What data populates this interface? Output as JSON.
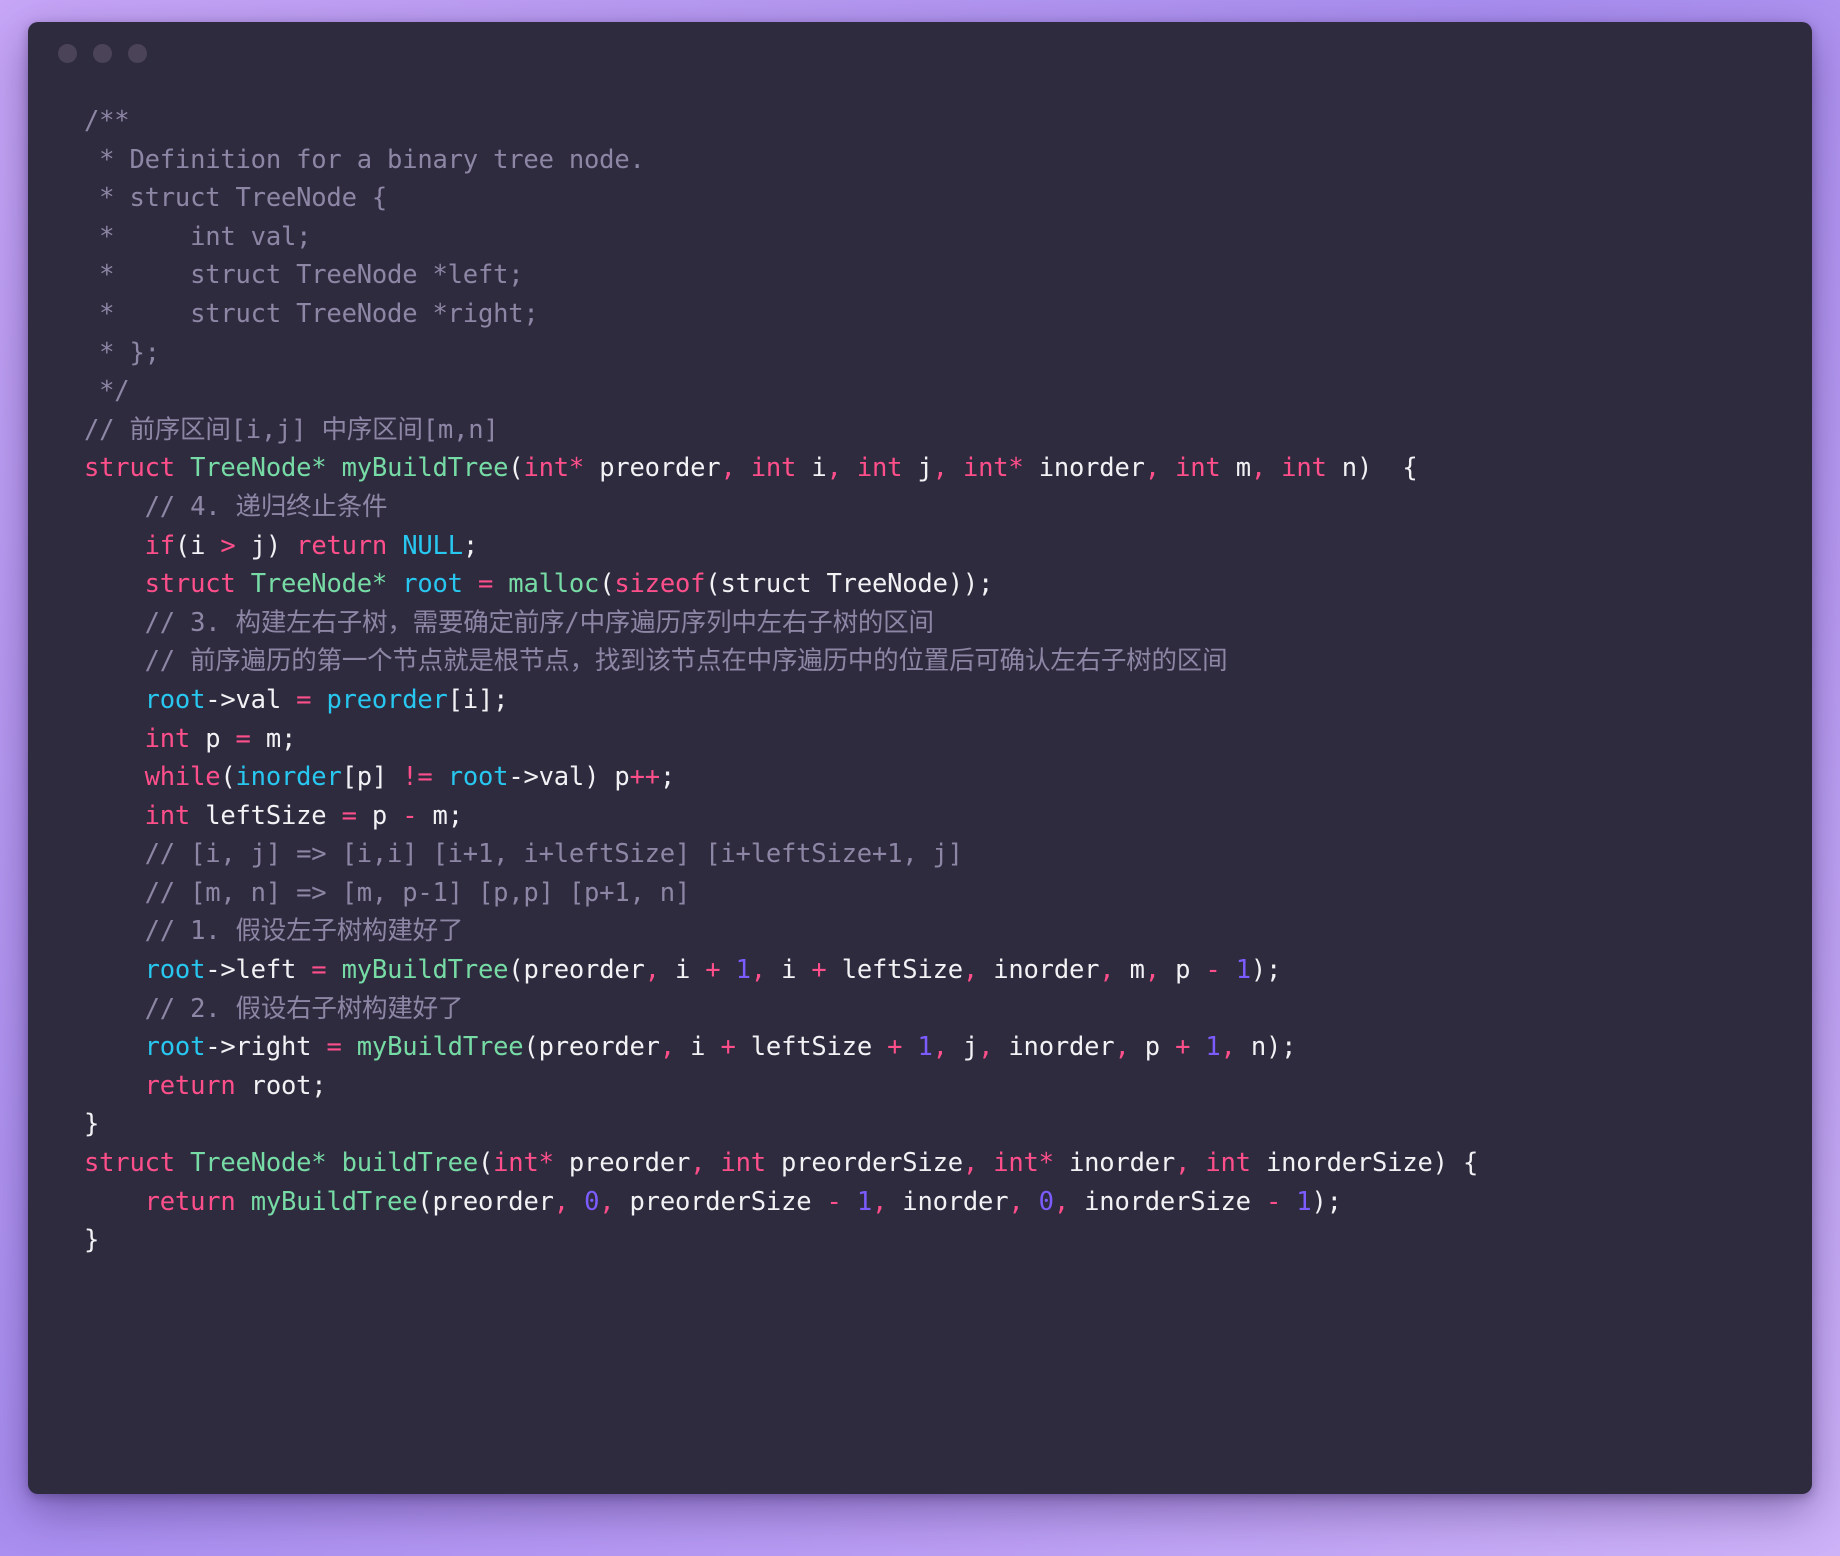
{
  "window": {
    "title": "",
    "traffic_lights": [
      {
        "name": "close",
        "color": "#4b4459"
      },
      {
        "name": "minimize",
        "color": "#4b4459"
      },
      {
        "name": "maximize",
        "color": "#4b4459"
      }
    ],
    "background_gradient": [
      "#c7a6f7",
      "#a98ef0",
      "#cdb2f8"
    ],
    "editor_background": "#2f2b3f"
  },
  "theme": {
    "comment": "#8d86a5",
    "keyword": "#ff4f8b",
    "function": "#76dba5",
    "type": "#76dba5",
    "variable": "#28c7f0",
    "number": "#7c5cff",
    "plain": "#f2f2f5"
  },
  "code": {
    "language": "c",
    "lines": [
      "/**",
      " * Definition for a binary tree node.",
      " * struct TreeNode {",
      " *     int val;",
      " *     struct TreeNode *left;",
      " *     struct TreeNode *right;",
      " * };",
      " */",
      "// 前序区间[i,j] 中序区间[m,n]",
      "struct TreeNode* myBuildTree(int* preorder, int i, int j, int* inorder, int m, int n)  {",
      "    // 4. 递归终止条件",
      "    if(i > j) return NULL;",
      "    struct TreeNode* root = malloc(sizeof(struct TreeNode));",
      "    // 3. 构建左右子树，需要确定前序/中序遍历序列中左右子树的区间",
      "    // 前序遍历的第一个节点就是根节点，找到该节点在中序遍历中的位置后可确认左右子树的区间",
      "    root->val = preorder[i];",
      "    int p = m;",
      "    while(inorder[p] != root->val) p++;",
      "    int leftSize = p - m;",
      "    // [i, j] => [i,i] [i+1, i+leftSize] [i+leftSize+1, j]",
      "    // [m, n] => [m, p-1] [p,p] [p+1, n]",
      "    // 1. 假设左子树构建好了",
      "    root->left = myBuildTree(preorder, i + 1, i + leftSize, inorder, m, p - 1);",
      "    // 2. 假设右子树构建好了",
      "    root->right = myBuildTree(preorder, i + leftSize + 1, j, inorder, p + 1, n);",
      "    return root;",
      "}",
      "struct TreeNode* buildTree(int* preorder, int preorderSize, int* inorder, int inorderSize) {",
      "    return myBuildTree(preorder, 0, preorderSize - 1, inorder, 0, inorderSize - 1);",
      "}"
    ],
    "tokens": [
      [
        [
          "cmt",
          "/**"
        ]
      ],
      [
        [
          "cmt",
          " * Definition for a binary tree node."
        ]
      ],
      [
        [
          "cmt",
          " * struct TreeNode {"
        ]
      ],
      [
        [
          "cmt",
          " *     int val;"
        ]
      ],
      [
        [
          "cmt",
          " *     struct TreeNode *left;"
        ]
      ],
      [
        [
          "cmt",
          " *     struct TreeNode *right;"
        ]
      ],
      [
        [
          "cmt",
          " * };"
        ]
      ],
      [
        [
          "cmt",
          " */"
        ]
      ],
      [
        [
          "cmt",
          "// 前序区间[i,j] 中序区间[m,n]"
        ]
      ],
      [
        [
          "kw",
          "struct"
        ],
        [
          "txt",
          " "
        ],
        [
          "typ",
          "TreeNode*"
        ],
        [
          "txt",
          " "
        ],
        [
          "fn",
          "myBuildTree"
        ],
        [
          "pun",
          "("
        ],
        [
          "kw",
          "int*"
        ],
        [
          "txt",
          " preorder"
        ],
        [
          "op",
          ","
        ],
        [
          "txt",
          " "
        ],
        [
          "kw",
          "int"
        ],
        [
          "txt",
          " i"
        ],
        [
          "op",
          ","
        ],
        [
          "txt",
          " "
        ],
        [
          "kw",
          "int"
        ],
        [
          "txt",
          " j"
        ],
        [
          "op",
          ","
        ],
        [
          "txt",
          " "
        ],
        [
          "kw",
          "int*"
        ],
        [
          "txt",
          " inorder"
        ],
        [
          "op",
          ","
        ],
        [
          "txt",
          " "
        ],
        [
          "kw",
          "int"
        ],
        [
          "txt",
          " m"
        ],
        [
          "op",
          ","
        ],
        [
          "txt",
          " "
        ],
        [
          "kw",
          "int"
        ],
        [
          "txt",
          " n"
        ],
        [
          "pun",
          ")  {"
        ]
      ],
      [
        [
          "txt",
          "    "
        ],
        [
          "cmt",
          "// 4. 递归终止条件"
        ]
      ],
      [
        [
          "txt",
          "    "
        ],
        [
          "kw",
          "if"
        ],
        [
          "pun",
          "("
        ],
        [
          "txt",
          "i "
        ],
        [
          "op",
          ">"
        ],
        [
          "txt",
          " j"
        ],
        [
          "pun",
          ")"
        ],
        [
          "txt",
          " "
        ],
        [
          "kw",
          "return"
        ],
        [
          "txt",
          " "
        ],
        [
          "var",
          "NULL"
        ],
        [
          "pun",
          ";"
        ]
      ],
      [
        [
          "txt",
          "    "
        ],
        [
          "kw",
          "struct"
        ],
        [
          "txt",
          " "
        ],
        [
          "typ",
          "TreeNode*"
        ],
        [
          "txt",
          " "
        ],
        [
          "var",
          "root"
        ],
        [
          "txt",
          " "
        ],
        [
          "op",
          "="
        ],
        [
          "txt",
          " "
        ],
        [
          "fn",
          "malloc"
        ],
        [
          "pun",
          "("
        ],
        [
          "kw",
          "sizeof"
        ],
        [
          "pun",
          "("
        ],
        [
          "txt",
          "struct TreeNode"
        ],
        [
          "pun",
          "));"
        ]
      ],
      [
        [
          "txt",
          "    "
        ],
        [
          "cmt",
          "// 3. 构建左右子树，需要确定前序/中序遍历序列中左右子树的区间"
        ]
      ],
      [
        [
          "txt",
          "    "
        ],
        [
          "cmt",
          "// 前序遍历的第一个节点就是根节点，找到该节点在中序遍历中的位置后可确认左右子树的区间"
        ]
      ],
      [
        [
          "txt",
          "    "
        ],
        [
          "var",
          "root"
        ],
        [
          "pun",
          "->"
        ],
        [
          "txt",
          "val "
        ],
        [
          "op",
          "="
        ],
        [
          "txt",
          " "
        ],
        [
          "var",
          "preorder"
        ],
        [
          "pun",
          "["
        ],
        [
          "txt",
          "i"
        ],
        [
          "pun",
          "];"
        ]
      ],
      [
        [
          "txt",
          "    "
        ],
        [
          "kw",
          "int"
        ],
        [
          "txt",
          " p "
        ],
        [
          "op",
          "="
        ],
        [
          "txt",
          " m;"
        ]
      ],
      [
        [
          "txt",
          "    "
        ],
        [
          "kw",
          "while"
        ],
        [
          "pun",
          "("
        ],
        [
          "var",
          "inorder"
        ],
        [
          "pun",
          "["
        ],
        [
          "txt",
          "p"
        ],
        [
          "pun",
          "]"
        ],
        [
          "txt",
          " "
        ],
        [
          "op",
          "!="
        ],
        [
          "txt",
          " "
        ],
        [
          "var",
          "root"
        ],
        [
          "pun",
          "->"
        ],
        [
          "txt",
          "val"
        ],
        [
          "pun",
          ")"
        ],
        [
          "txt",
          " p"
        ],
        [
          "op",
          "++"
        ],
        [
          "pun",
          ";"
        ]
      ],
      [
        [
          "txt",
          "    "
        ],
        [
          "kw",
          "int"
        ],
        [
          "txt",
          " leftSize "
        ],
        [
          "op",
          "="
        ],
        [
          "txt",
          " p "
        ],
        [
          "op",
          "-"
        ],
        [
          "txt",
          " m;"
        ]
      ],
      [
        [
          "txt",
          "    "
        ],
        [
          "cmt",
          "// [i, j] => [i,i] [i+1, i+leftSize] [i+leftSize+1, j]"
        ]
      ],
      [
        [
          "txt",
          "    "
        ],
        [
          "cmt",
          "// [m, n] => [m, p-1] [p,p] [p+1, n]"
        ]
      ],
      [
        [
          "txt",
          "    "
        ],
        [
          "cmt",
          "// 1. 假设左子树构建好了"
        ]
      ],
      [
        [
          "txt",
          "    "
        ],
        [
          "var",
          "root"
        ],
        [
          "pun",
          "->"
        ],
        [
          "txt",
          "left "
        ],
        [
          "op",
          "="
        ],
        [
          "txt",
          " "
        ],
        [
          "fn",
          "myBuildTree"
        ],
        [
          "pun",
          "("
        ],
        [
          "txt",
          "preorder"
        ],
        [
          "op",
          ","
        ],
        [
          "txt",
          " i "
        ],
        [
          "op",
          "+"
        ],
        [
          "txt",
          " "
        ],
        [
          "num",
          "1"
        ],
        [
          "op",
          ","
        ],
        [
          "txt",
          " i "
        ],
        [
          "op",
          "+"
        ],
        [
          "txt",
          " leftSize"
        ],
        [
          "op",
          ","
        ],
        [
          "txt",
          " inorder"
        ],
        [
          "op",
          ","
        ],
        [
          "txt",
          " m"
        ],
        [
          "op",
          ","
        ],
        [
          "txt",
          " p "
        ],
        [
          "op",
          "-"
        ],
        [
          "txt",
          " "
        ],
        [
          "num",
          "1"
        ],
        [
          "pun",
          ");"
        ]
      ],
      [
        [
          "txt",
          "    "
        ],
        [
          "cmt",
          "// 2. 假设右子树构建好了"
        ]
      ],
      [
        [
          "txt",
          "    "
        ],
        [
          "var",
          "root"
        ],
        [
          "pun",
          "->"
        ],
        [
          "txt",
          "right "
        ],
        [
          "op",
          "="
        ],
        [
          "txt",
          " "
        ],
        [
          "fn",
          "myBuildTree"
        ],
        [
          "pun",
          "("
        ],
        [
          "txt",
          "preorder"
        ],
        [
          "op",
          ","
        ],
        [
          "txt",
          " i "
        ],
        [
          "op",
          "+"
        ],
        [
          "txt",
          " leftSize "
        ],
        [
          "op",
          "+"
        ],
        [
          "txt",
          " "
        ],
        [
          "num",
          "1"
        ],
        [
          "op",
          ","
        ],
        [
          "txt",
          " j"
        ],
        [
          "op",
          ","
        ],
        [
          "txt",
          " inorder"
        ],
        [
          "op",
          ","
        ],
        [
          "txt",
          " p "
        ],
        [
          "op",
          "+"
        ],
        [
          "txt",
          " "
        ],
        [
          "num",
          "1"
        ],
        [
          "op",
          ","
        ],
        [
          "txt",
          " n"
        ],
        [
          "pun",
          ");"
        ]
      ],
      [
        [
          "txt",
          "    "
        ],
        [
          "kw",
          "return"
        ],
        [
          "txt",
          " root;"
        ]
      ],
      [
        [
          "pun",
          "}"
        ]
      ],
      [
        [
          "kw",
          "struct"
        ],
        [
          "txt",
          " "
        ],
        [
          "typ",
          "TreeNode*"
        ],
        [
          "txt",
          " "
        ],
        [
          "fn",
          "buildTree"
        ],
        [
          "pun",
          "("
        ],
        [
          "kw",
          "int*"
        ],
        [
          "txt",
          " preorder"
        ],
        [
          "op",
          ","
        ],
        [
          "txt",
          " "
        ],
        [
          "kw",
          "int"
        ],
        [
          "txt",
          " preorderSize"
        ],
        [
          "op",
          ","
        ],
        [
          "txt",
          " "
        ],
        [
          "kw",
          "int*"
        ],
        [
          "txt",
          " inorder"
        ],
        [
          "op",
          ","
        ],
        [
          "txt",
          " "
        ],
        [
          "kw",
          "int"
        ],
        [
          "txt",
          " inorderSize"
        ],
        [
          "pun",
          ") {"
        ]
      ],
      [
        [
          "txt",
          "    "
        ],
        [
          "kw",
          "return"
        ],
        [
          "txt",
          " "
        ],
        [
          "fn",
          "myBuildTree"
        ],
        [
          "pun",
          "("
        ],
        [
          "txt",
          "preorder"
        ],
        [
          "op",
          ","
        ],
        [
          "txt",
          " "
        ],
        [
          "num",
          "0"
        ],
        [
          "op",
          ","
        ],
        [
          "txt",
          " preorderSize "
        ],
        [
          "op",
          "-"
        ],
        [
          "txt",
          " "
        ],
        [
          "num",
          "1"
        ],
        [
          "op",
          ","
        ],
        [
          "txt",
          " inorder"
        ],
        [
          "op",
          ","
        ],
        [
          "txt",
          " "
        ],
        [
          "num",
          "0"
        ],
        [
          "op",
          ","
        ],
        [
          "txt",
          " inorderSize "
        ],
        [
          "op",
          "-"
        ],
        [
          "txt",
          " "
        ],
        [
          "num",
          "1"
        ],
        [
          "pun",
          ");"
        ]
      ],
      [
        [
          "pun",
          "}"
        ]
      ]
    ]
  }
}
